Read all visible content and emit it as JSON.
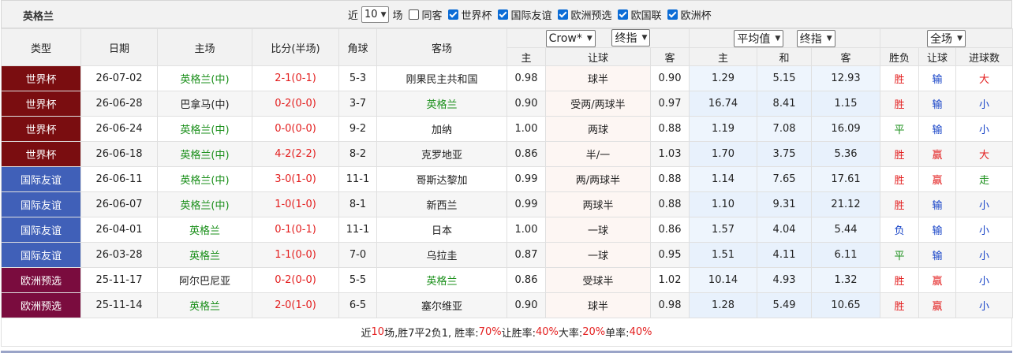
{
  "team": "英格兰",
  "filters": {
    "near": "近",
    "count": "10",
    "unit": "场",
    "same_home": "同客",
    "checks": [
      "世界杯",
      "国际友谊",
      "欧洲预选",
      "欧国联",
      "欧洲杯"
    ]
  },
  "header": {
    "type": "类型",
    "date": "日期",
    "home": "主场",
    "score": "比分(半场)",
    "corner": "角球",
    "away": "客场",
    "company": "Crow*",
    "final1": "终指",
    "avg": "平均值",
    "final2": "终指",
    "all": "全场",
    "sub": [
      "主",
      "让球",
      "客",
      "主",
      "和",
      "客",
      "胜负",
      "让球",
      "进球数"
    ]
  },
  "rows": [
    {
      "type": "世界杯",
      "color": "#7a0d10",
      "date": "26-07-02",
      "home": "英格兰(中)",
      "home_green": true,
      "score": "2-1(0-1)",
      "corner": "5-3",
      "away": "刚果民主共和国",
      "away_green": false,
      "o1": "0.98",
      "hc": "球半",
      "o2": "0.90",
      "a1": "1.29",
      "a2": "5.15",
      "a3": "12.93",
      "r1": "胜",
      "r2": "输",
      "r3": "大"
    },
    {
      "type": "世界杯",
      "color": "#7a0d10",
      "date": "26-06-28",
      "home": "巴拿马(中)",
      "home_green": false,
      "score": "0-2(0-0)",
      "corner": "3-7",
      "away": "英格兰",
      "away_green": true,
      "o1": "0.90",
      "hc": "受两/两球半",
      "o2": "0.97",
      "a1": "16.74",
      "a2": "8.41",
      "a3": "1.15",
      "r1": "胜",
      "r2": "输",
      "r3": "小"
    },
    {
      "type": "世界杯",
      "color": "#7a0d10",
      "date": "26-06-24",
      "home": "英格兰(中)",
      "home_green": true,
      "score": "0-0(0-0)",
      "corner": "9-2",
      "away": "加纳",
      "away_green": false,
      "o1": "1.00",
      "hc": "两球",
      "o2": "0.88",
      "a1": "1.19",
      "a2": "7.08",
      "a3": "16.09",
      "r1": "平",
      "r2": "输",
      "r3": "小"
    },
    {
      "type": "世界杯",
      "color": "#7a0d10",
      "date": "26-06-18",
      "home": "英格兰(中)",
      "home_green": true,
      "score": "4-2(2-2)",
      "corner": "8-2",
      "away": "克罗地亚",
      "away_green": false,
      "o1": "0.86",
      "hc": "半/一",
      "o2": "1.03",
      "a1": "1.70",
      "a2": "3.75",
      "a3": "5.36",
      "r1": "胜",
      "r2": "赢",
      "r3": "大"
    },
    {
      "type": "国际友谊",
      "color": "#4060b8",
      "date": "26-06-11",
      "home": "英格兰(中)",
      "home_green": true,
      "score": "3-0(1-0)",
      "corner": "11-1",
      "away": "哥斯达黎加",
      "away_green": false,
      "o1": "0.99",
      "hc": "两/两球半",
      "o2": "0.88",
      "a1": "1.14",
      "a2": "7.65",
      "a3": "17.61",
      "r1": "胜",
      "r2": "赢",
      "r3": "走"
    },
    {
      "type": "国际友谊",
      "color": "#4060b8",
      "date": "26-06-07",
      "home": "英格兰(中)",
      "home_green": true,
      "score": "1-0(1-0)",
      "corner": "8-1",
      "away": "新西兰",
      "away_green": false,
      "o1": "0.99",
      "hc": "两球半",
      "o2": "0.88",
      "a1": "1.10",
      "a2": "9.31",
      "a3": "21.12",
      "r1": "胜",
      "r2": "输",
      "r3": "小"
    },
    {
      "type": "国际友谊",
      "color": "#4060b8",
      "date": "26-04-01",
      "home": "英格兰",
      "home_green": true,
      "score": "0-1(0-1)",
      "corner": "11-1",
      "away": "日本",
      "away_green": false,
      "o1": "1.00",
      "hc": "一球",
      "o2": "0.86",
      "a1": "1.57",
      "a2": "4.04",
      "a3": "5.44",
      "r1": "负",
      "r2": "输",
      "r3": "小"
    },
    {
      "type": "国际友谊",
      "color": "#4060b8",
      "date": "26-03-28",
      "home": "英格兰",
      "home_green": true,
      "score": "1-1(0-0)",
      "corner": "7-0",
      "away": "乌拉圭",
      "away_green": false,
      "o1": "0.87",
      "hc": "一球",
      "o2": "0.95",
      "a1": "1.51",
      "a2": "4.11",
      "a3": "6.11",
      "r1": "平",
      "r2": "输",
      "r3": "小"
    },
    {
      "type": "欧洲预选",
      "color": "#7a0c3e",
      "date": "25-11-17",
      "home": "阿尔巴尼亚",
      "home_green": false,
      "score": "0-2(0-0)",
      "corner": "5-5",
      "away": "英格兰",
      "away_green": true,
      "o1": "0.86",
      "hc": "受球半",
      "o2": "1.02",
      "a1": "10.14",
      "a2": "4.93",
      "a3": "1.32",
      "r1": "胜",
      "r2": "赢",
      "r3": "小"
    },
    {
      "type": "欧洲预选",
      "color": "#7a0c3e",
      "date": "25-11-14",
      "home": "英格兰",
      "home_green": true,
      "score": "2-0(1-0)",
      "corner": "6-5",
      "away": "塞尔维亚",
      "away_green": false,
      "o1": "0.90",
      "hc": "球半",
      "o2": "0.98",
      "a1": "1.28",
      "a2": "5.49",
      "a3": "10.65",
      "r1": "胜",
      "r2": "赢",
      "r3": "小"
    }
  ],
  "summary": {
    "p1": "近",
    "n": "10",
    "p2": "场,胜7平2负1, 胜率:",
    "win": "70%",
    "p3": " 让胜率:",
    "hwin": "40%",
    "p4": " 大率:",
    "big": "20%",
    "p5": " 单率:",
    "odd": "40%"
  }
}
